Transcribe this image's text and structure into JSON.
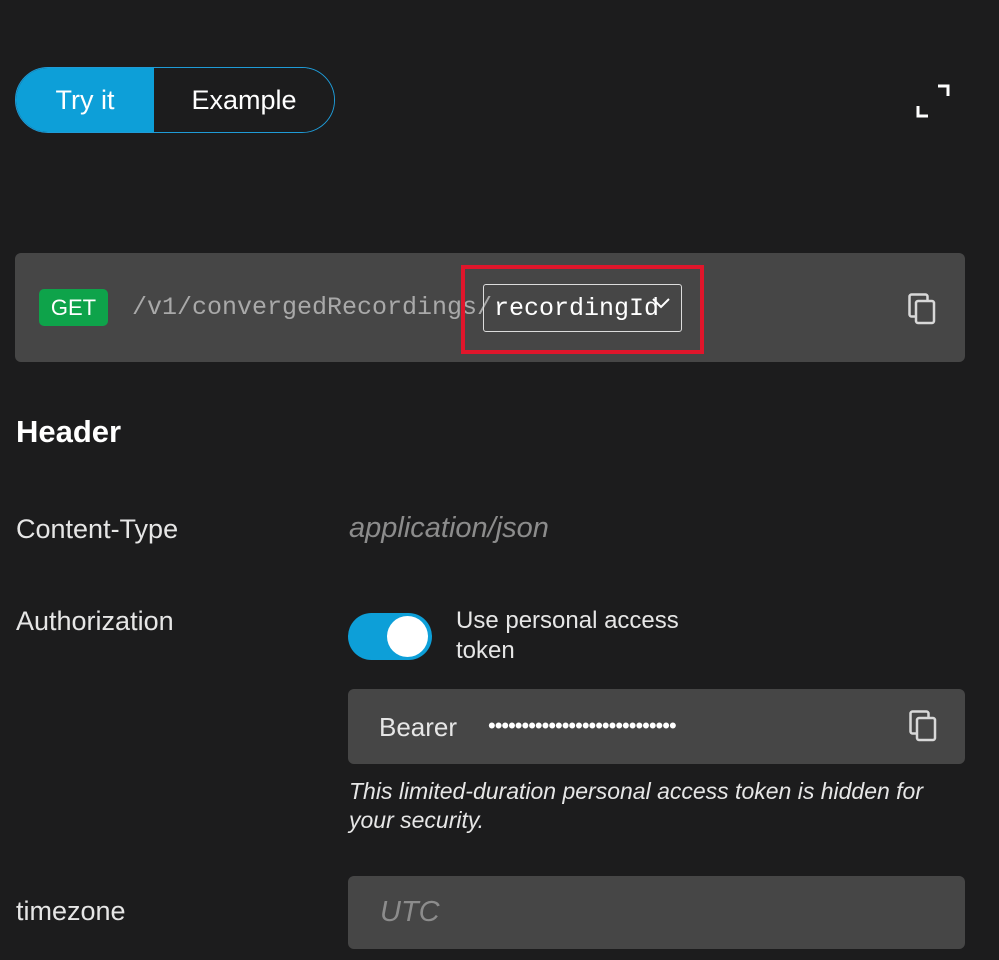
{
  "tabs": [
    {
      "label": "Try it",
      "active": true
    },
    {
      "label": "Example",
      "active": false
    }
  ],
  "icons": {
    "expand": "expand-icon",
    "copy": "copy-icon",
    "chevron": "chevron-down-icon"
  },
  "endpoint": {
    "method": "GET",
    "path": "/v1/convergedRecordings/",
    "param": "recordingId"
  },
  "header": {
    "title": "Header",
    "content_type": {
      "label": "Content-Type",
      "value": "application/json"
    },
    "authorization": {
      "label": "Authorization",
      "toggle_on": true,
      "toggle_label": "Use personal access token",
      "bearer_label": "Bearer",
      "token_masked": "••••••••••••••••••••••••••••",
      "note": "This limited-duration personal access token is hidden for your security."
    },
    "timezone": {
      "label": "timezone",
      "placeholder": "UTC",
      "value": ""
    }
  },
  "colors": {
    "background": "#1c1c1d",
    "accent": "#0d9fd8",
    "get_badge": "#0ea34a",
    "highlight": "#e0162b",
    "field_bg": "#464646"
  }
}
